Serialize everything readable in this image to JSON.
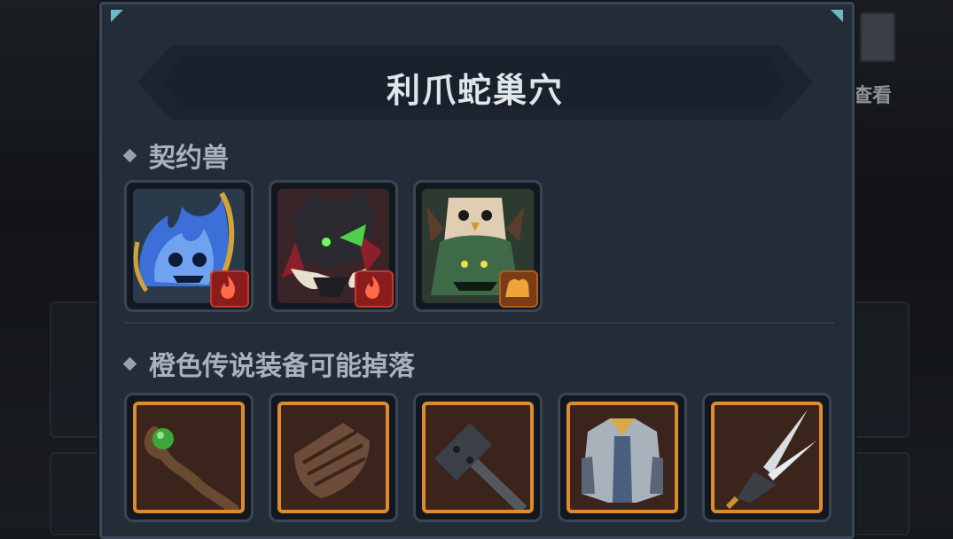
{
  "background": {
    "view_button_label": "查看"
  },
  "panel": {
    "title": "利爪蛇巢穴",
    "pets_section": {
      "heading": "契约兽",
      "pets": [
        {
          "name": "blue-flame-spirit",
          "element": "fire-icon"
        },
        {
          "name": "dark-horned-beast",
          "element": "fire-icon"
        },
        {
          "name": "forest-owl-totem",
          "element": "earth-icon"
        }
      ]
    },
    "loot_section": {
      "heading": "橙色传说装备可能掉落",
      "items": [
        {
          "name": "green-orb-staff",
          "rarity": "orange"
        },
        {
          "name": "wrapped-bracer",
          "rarity": "orange"
        },
        {
          "name": "iron-hammer",
          "rarity": "orange"
        },
        {
          "name": "gold-trim-robe",
          "rarity": "orange"
        },
        {
          "name": "feather-dagger",
          "rarity": "orange"
        }
      ]
    }
  },
  "colors": {
    "panel_bg": "#242c38",
    "legendary_border": "#e08a2e",
    "fire_badge": "#8a1d1b",
    "earth_badge": "#7a3c14"
  }
}
